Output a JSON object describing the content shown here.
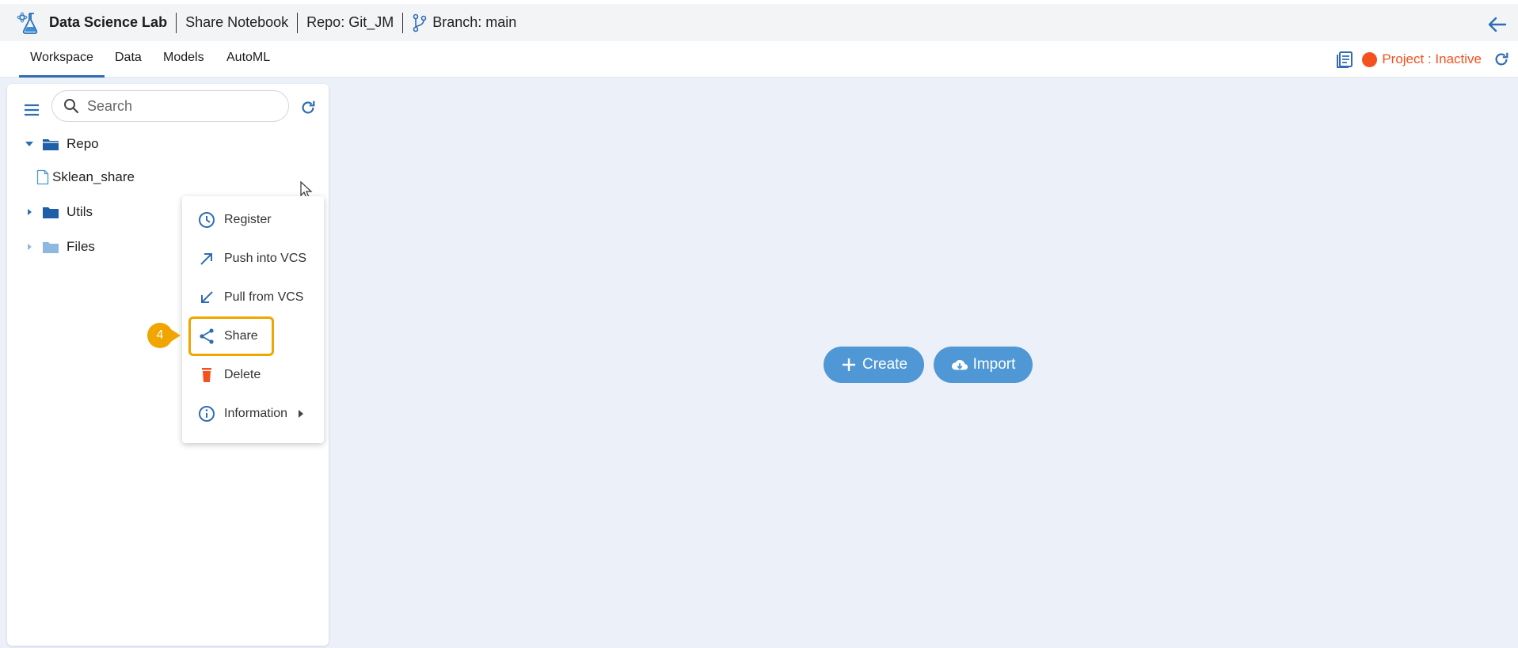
{
  "header": {
    "app_title": "Data Science Lab",
    "notebook": "Share Notebook",
    "repo": "Repo: Git_JM",
    "branch": "Branch: main"
  },
  "tabs": [
    {
      "label": "Workspace",
      "active": true
    },
    {
      "label": "Data",
      "active": false
    },
    {
      "label": "Models",
      "active": false
    },
    {
      "label": "AutoML",
      "active": false
    }
  ],
  "project": {
    "status_text": "Project : Inactive",
    "status_color": "#f4511e"
  },
  "sidebar": {
    "search_placeholder": "Search",
    "tree": [
      {
        "label": "Repo",
        "type": "folder",
        "expanded": true
      },
      {
        "label": "Sklean_share",
        "type": "file"
      },
      {
        "label": "Utils",
        "type": "folder",
        "expanded": false
      },
      {
        "label": "Files",
        "type": "folder",
        "expanded": false
      }
    ]
  },
  "context_menu": {
    "items": [
      {
        "label": "Register",
        "icon": "clock-icon"
      },
      {
        "label": "Push into VCS",
        "icon": "arrow-up-right-icon"
      },
      {
        "label": "Pull from VCS",
        "icon": "arrow-down-left-icon"
      },
      {
        "label": "Share",
        "icon": "share-icon"
      },
      {
        "label": "Delete",
        "icon": "trash-icon"
      },
      {
        "label": "Information",
        "icon": "info-icon"
      }
    ]
  },
  "annotation": {
    "step": "4",
    "color": "#f0a500"
  },
  "main": {
    "create_label": "Create",
    "import_label": "Import",
    "button_color": "#4f98d5"
  },
  "colors": {
    "accent": "#2f6db3",
    "background": "#ecf0f8"
  }
}
